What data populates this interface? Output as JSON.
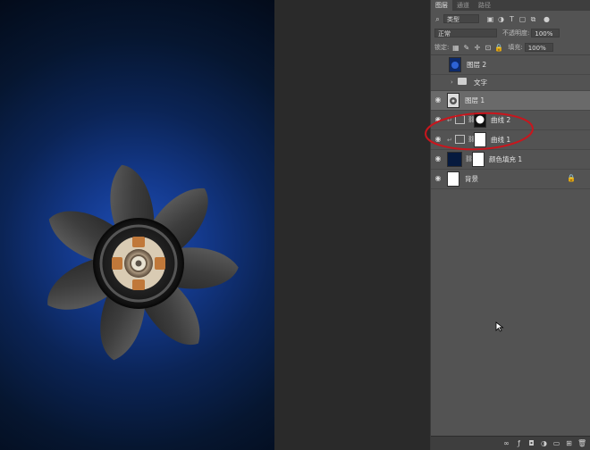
{
  "panel": {
    "tabs": [
      "图层",
      "通道",
      "路径"
    ],
    "filter_kind": "类型",
    "blend_mode": "正常",
    "opacity_label": "不透明度:",
    "opacity_value": "100%",
    "lock_label": "锁定:",
    "fill_label": "填充:",
    "fill_value": "100%"
  },
  "layers": [
    {
      "name": "图层 2",
      "visible": false,
      "thumb": "blue-fan"
    },
    {
      "name": "文字",
      "visible": false,
      "thumb": "folder"
    },
    {
      "name": "图层 1",
      "visible": true,
      "selected": true,
      "thumb": "fan"
    },
    {
      "name": "曲线 2",
      "visible": true,
      "thumb": "curves"
    },
    {
      "name": "曲线 1",
      "visible": true,
      "thumb": "curves"
    },
    {
      "name": "颜色填充 1",
      "visible": true,
      "thumb": "fill"
    },
    {
      "name": "背景",
      "visible": true,
      "thumb": "white",
      "locked": true
    }
  ],
  "colors": {
    "annotation": "#c8161d",
    "canvas_center": "#1f4fb8",
    "canvas_edge": "#030a18"
  },
  "icons": [
    "eye-icon",
    "folder-icon",
    "lock-icon",
    "link-icon",
    "curves-icon"
  ]
}
